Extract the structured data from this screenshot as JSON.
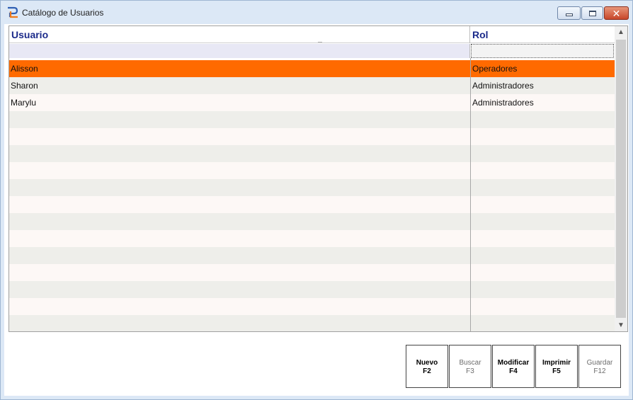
{
  "window": {
    "title": "Catálogo de Usuarios",
    "close_glyph": "✕"
  },
  "grid": {
    "columns": [
      "Usuario",
      "Rol"
    ],
    "filters": {
      "usuario": "",
      "rol": ""
    },
    "rows": [
      {
        "usuario": "Alisson",
        "rol": "Operadores",
        "selected": true
      },
      {
        "usuario": "Sharon",
        "rol": "Administradores",
        "selected": false
      },
      {
        "usuario": "Marylu",
        "rol": "Administradores",
        "selected": false
      },
      {
        "usuario": "",
        "rol": ""
      },
      {
        "usuario": "",
        "rol": ""
      },
      {
        "usuario": "",
        "rol": ""
      },
      {
        "usuario": "",
        "rol": ""
      },
      {
        "usuario": "",
        "rol": ""
      },
      {
        "usuario": "",
        "rol": ""
      },
      {
        "usuario": "",
        "rol": ""
      },
      {
        "usuario": "",
        "rol": ""
      },
      {
        "usuario": "",
        "rol": ""
      },
      {
        "usuario": "",
        "rol": ""
      },
      {
        "usuario": "",
        "rol": ""
      },
      {
        "usuario": "",
        "rol": ""
      },
      {
        "usuario": "",
        "rol": ""
      }
    ],
    "scroll_up_glyph": "▲",
    "scroll_down_glyph": "▼"
  },
  "toolbar": {
    "buttons": [
      {
        "label": "Nuevo",
        "key": "F2",
        "enabled": true
      },
      {
        "label": "Buscar",
        "key": "F3",
        "enabled": false
      },
      {
        "label": "Modificar",
        "key": "F4",
        "enabled": true
      },
      {
        "label": "Imprimir",
        "key": "F5",
        "enabled": true
      },
      {
        "label": "Guardar",
        "key": "F12",
        "enabled": false
      }
    ]
  },
  "colors": {
    "selected_row": "#ff6a00",
    "header_text": "#1b2a8a",
    "row_even": "#eeeeea",
    "row_odd": "#fdf8f6"
  },
  "icons": [
    "app-logo-icon",
    "minimize-icon",
    "maximize-icon",
    "close-icon",
    "scroll-up-icon",
    "scroll-down-icon"
  ]
}
